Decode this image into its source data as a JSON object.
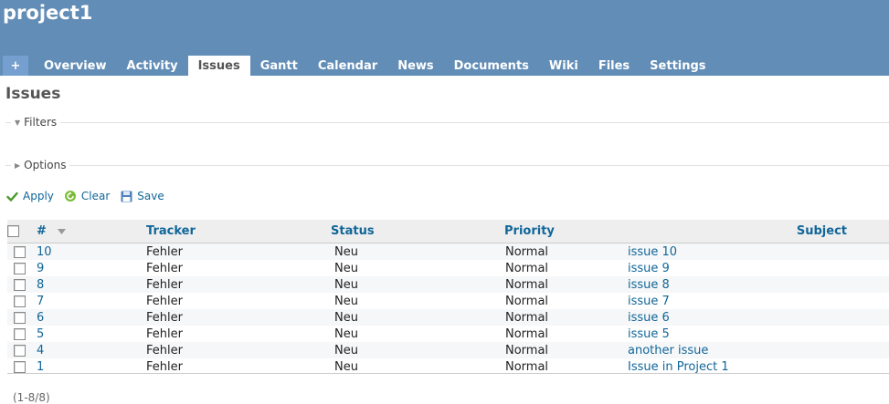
{
  "header": {
    "project_title": "project1"
  },
  "menu": {
    "new_item_label": "+",
    "tabs": [
      {
        "label": "Overview",
        "selected": false
      },
      {
        "label": "Activity",
        "selected": false
      },
      {
        "label": "Issues",
        "selected": true
      },
      {
        "label": "Gantt",
        "selected": false
      },
      {
        "label": "Calendar",
        "selected": false
      },
      {
        "label": "News",
        "selected": false
      },
      {
        "label": "Documents",
        "selected": false
      },
      {
        "label": "Wiki",
        "selected": false
      },
      {
        "label": "Files",
        "selected": false
      },
      {
        "label": "Settings",
        "selected": false
      }
    ]
  },
  "page": {
    "title": "Issues"
  },
  "filters": {
    "legend": "Filters",
    "expanded": true
  },
  "options": {
    "legend": "Options",
    "expanded": false
  },
  "actions": {
    "apply": "Apply",
    "clear": "Clear",
    "save": "Save"
  },
  "table": {
    "columns": {
      "id": "#",
      "tracker": "Tracker",
      "status": "Status",
      "priority": "Priority",
      "subject": "Subject"
    },
    "rows": [
      {
        "id": "10",
        "tracker": "Fehler",
        "status": "Neu",
        "priority": "Normal",
        "subject": "issue 10"
      },
      {
        "id": "9",
        "tracker": "Fehler",
        "status": "Neu",
        "priority": "Normal",
        "subject": "issue 9"
      },
      {
        "id": "8",
        "tracker": "Fehler",
        "status": "Neu",
        "priority": "Normal",
        "subject": "issue 8"
      },
      {
        "id": "7",
        "tracker": "Fehler",
        "status": "Neu",
        "priority": "Normal",
        "subject": "issue 7"
      },
      {
        "id": "6",
        "tracker": "Fehler",
        "status": "Neu",
        "priority": "Normal",
        "subject": "issue 6"
      },
      {
        "id": "5",
        "tracker": "Fehler",
        "status": "Neu",
        "priority": "Normal",
        "subject": "issue 5"
      },
      {
        "id": "4",
        "tracker": "Fehler",
        "status": "Neu",
        "priority": "Normal",
        "subject": "another issue"
      },
      {
        "id": "1",
        "tracker": "Fehler",
        "status": "Neu",
        "priority": "Normal",
        "subject": "Issue in Project 1"
      }
    ]
  },
  "pagination": {
    "text": "(1-8/8)"
  },
  "colors": {
    "header_bg": "#628db6",
    "link": "#116699",
    "apply_icon": "#4a9a2a"
  },
  "icons": {
    "apply": "checkmark-icon",
    "clear": "reload-icon",
    "save": "floppy-disk-icon",
    "sort": "sort-desc-icon"
  }
}
